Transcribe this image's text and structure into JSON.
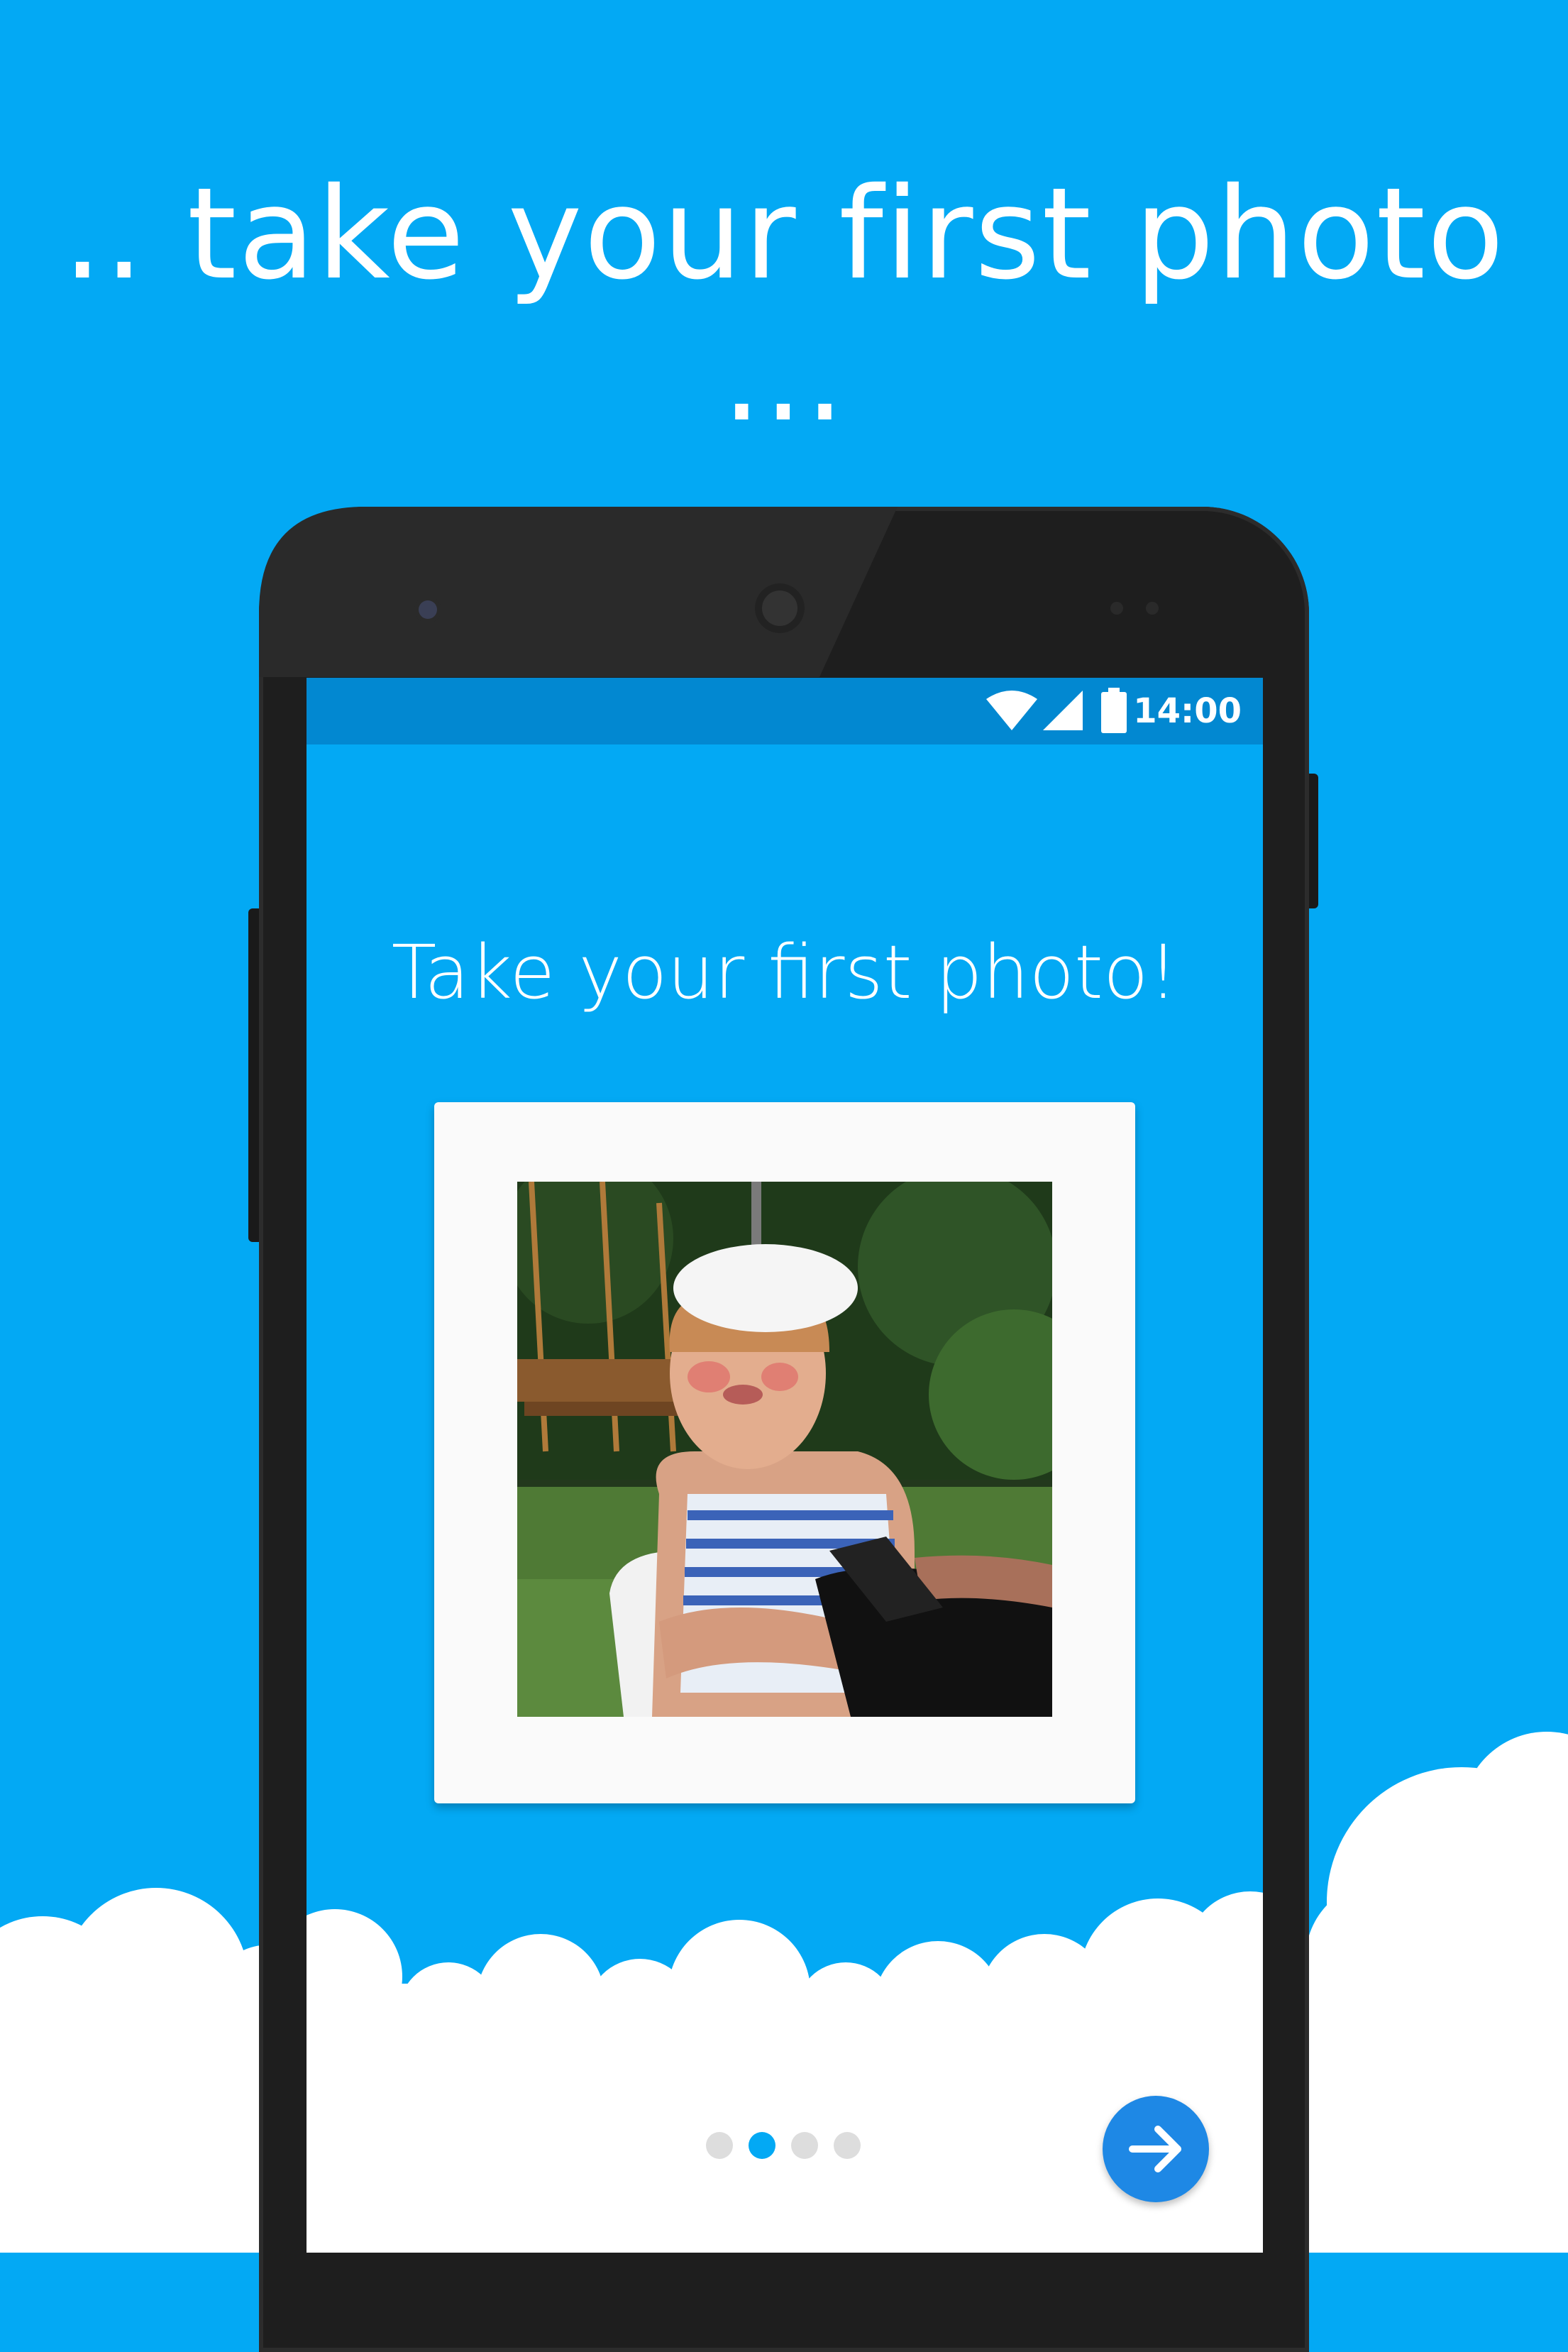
{
  "headline": ".. take your first photo ...",
  "status_bar": {
    "time": "14:00",
    "icons": [
      "wifi-icon",
      "cellular-signal-icon",
      "battery-icon"
    ]
  },
  "screen": {
    "title": "Take your first photo!",
    "photo_description": "child-in-sailor-hat-photo"
  },
  "pager": {
    "page_count": 4,
    "active_index": 1
  },
  "next_button": {
    "icon": "arrow-right-icon"
  },
  "colors": {
    "background": "#03A9F4",
    "status_bar": "#0288D1",
    "fab": "#1E88E5",
    "dot_inactive": "#DDDDDD",
    "dot_active": "#03A9F4",
    "card": "#FAFAFA"
  }
}
